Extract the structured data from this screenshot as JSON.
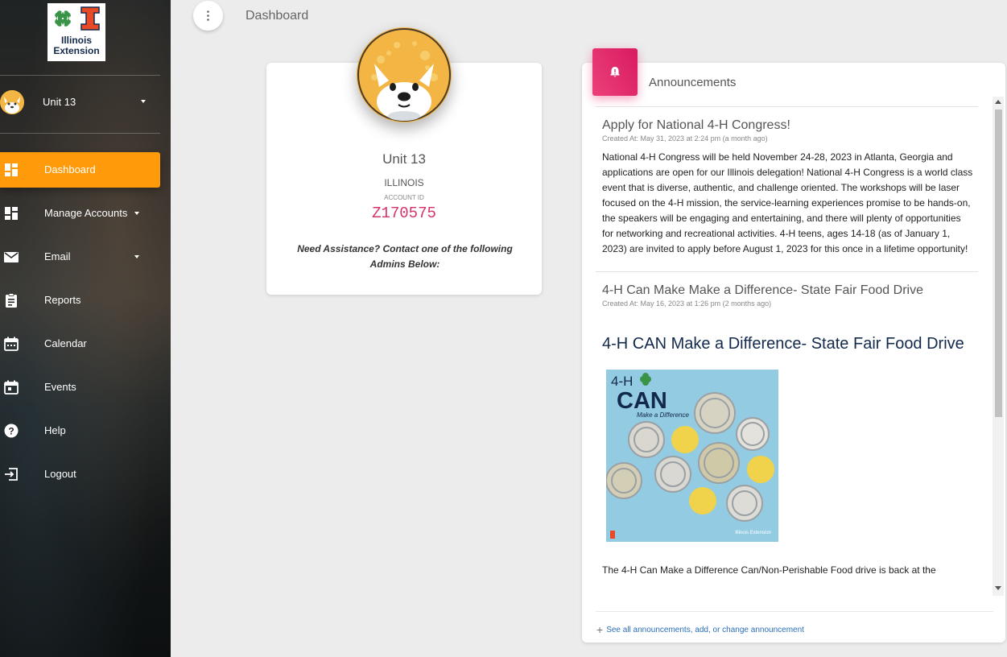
{
  "brand": {
    "logo_line1": "Illinois",
    "logo_line2": "Extension"
  },
  "user": {
    "name": "Unit 13"
  },
  "nav": [
    {
      "label": "Dashboard",
      "icon": "dashboard-icon",
      "active": true
    },
    {
      "label": "Manage Accounts",
      "icon": "dashboard-icon",
      "has_submenu": true
    },
    {
      "label": "Email",
      "icon": "mail-icon",
      "has_submenu": true
    },
    {
      "label": "Reports",
      "icon": "clipboard-icon"
    },
    {
      "label": "Calendar",
      "icon": "calendar-icon"
    },
    {
      "label": "Events",
      "icon": "event-icon"
    },
    {
      "label": "Help",
      "icon": "help-icon"
    },
    {
      "label": "Logout",
      "icon": "logout-icon"
    }
  ],
  "header": {
    "title": "Dashboard"
  },
  "profile": {
    "name": "Unit 13",
    "state": "ILLINOIS",
    "account_id_label": "ACCOUNT ID",
    "account_id": "Z170575",
    "help_text": "Need Assistance? Contact one of the following Admins Below:"
  },
  "announcements": {
    "title": "Announcements",
    "items": [
      {
        "title": "Apply for National 4-H Congress!",
        "date": "Created At: May 31, 2023 at 2:24 pm (a month ago)",
        "body": "National 4-H Congress will be held November 24-28, 2023 in Atlanta, Georgia and applications are open for our Illinois delegation! National 4-H Congress is a world class event that is diverse, authentic, and challenge oriented. The workshops will be laser focused on the 4-H mission, the service-learning experiences promise to be hands-on, the speakers will be engaging and entertaining, and there will plenty of opportunities for networking and recreational activities.  4-H teens, ages 14-18 (as of January 1, 2023) are invited to apply before August 1, 2023 for this once in a lifetime opportunity!"
      },
      {
        "title": "4-H Can Make Make a Difference- State Fair Food Drive",
        "date": "Created At: May 16, 2023 at 1:26 pm (2 months ago)",
        "heading": "4-H CAN Make a Difference- State Fair Food Drive",
        "image_text": {
          "brand": "4-H",
          "word": "CAN",
          "tagline": "Make a Difference",
          "logo": "Illinois Extension"
        },
        "body_start": "The 4-H Can Make a Difference Can/Non-Perishable Food drive is back at the"
      }
    ],
    "footer_link": "See all announcements, add, or change announcement"
  },
  "colors": {
    "accent": "#ff9a0a",
    "pink": "#e91e63",
    "id": "#d6336c",
    "navy": "#13294b",
    "orange": "#e84a27",
    "clover": "#3a9447"
  }
}
